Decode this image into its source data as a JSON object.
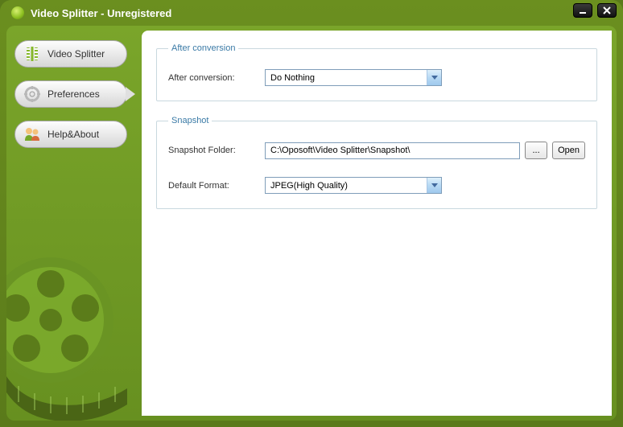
{
  "window": {
    "title": "Video Splitter - Unregistered"
  },
  "sidebar": {
    "items": [
      {
        "label": "Video Splitter"
      },
      {
        "label": "Preferences"
      },
      {
        "label": "Help&About"
      }
    ]
  },
  "groups": {
    "after_conversion": {
      "legend": "After conversion",
      "label": "After conversion:",
      "value": "Do Nothing"
    },
    "snapshot": {
      "legend": "Snapshot",
      "folder_label": "Snapshot Folder:",
      "folder_value": "C:\\Oposoft\\Video Splitter\\Snapshot\\",
      "browse_label": "...",
      "open_label": "Open",
      "format_label": "Default Format:",
      "format_value": "JPEG(High Quality)"
    }
  }
}
